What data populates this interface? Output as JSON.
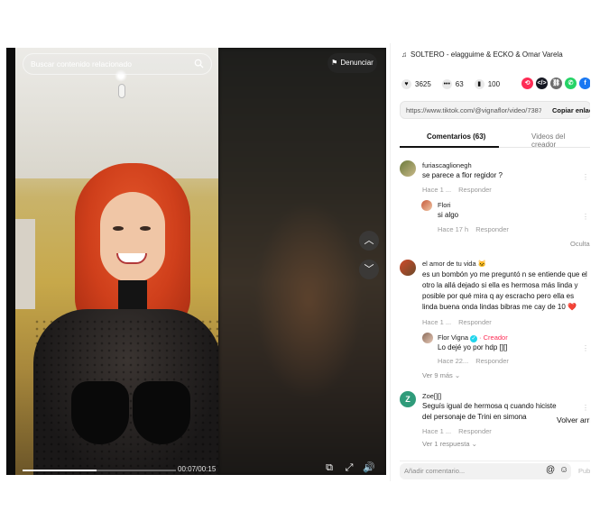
{
  "player": {
    "search_placeholder": "Buscar contenido relacionado",
    "report_label": "Denunciar",
    "report_icon": "flag-icon",
    "up_icon": "chevron-up-icon",
    "down_icon": "chevron-down-icon",
    "time": "00:07/00:15",
    "progress_fraction": 0.48
  },
  "panel": {
    "music": "SOLTERO - elagguime & ECKO & Omar Varela",
    "stats": {
      "likes": "3625",
      "comments": "63",
      "saves": "100"
    },
    "share_colors": [
      "#fe2c55",
      "#161823",
      "#6d6d6d",
      "#25d366",
      "#1877f2"
    ],
    "link": "https://www.tiktok.com/@vignaflor/video/738758...",
    "copy_label": "Copiar enlace",
    "tabs": {
      "comments": "Comentarios (63)",
      "videos": "Videos del creador"
    },
    "hide_label": "Ocultar",
    "back_to_top": "Volver arriba",
    "comment_placeholder": "Añadir comentario...",
    "post_label": "Publicar"
  },
  "comments": [
    {
      "user": "furiascaglionegh",
      "text": "se parece a flor regidor ?",
      "time": "Hace 1 ...",
      "reply": "Responder",
      "replies": [
        {
          "user": "Flori",
          "text": "si algo",
          "time": "Hace 17 h",
          "reply": "Responder"
        }
      ]
    },
    {
      "user": "el amor de tu vida 🐱",
      "text": "es un bombón yo me preguntó n se entiende que el otro la allá dejado si ella es hermosa más linda y posible por qué mira q ay escracho pero ella es linda buena onda lindas bibras me cay de 10 ❤️",
      "time": "Hace 1 ...",
      "reply": "Responder",
      "replies": [
        {
          "user": "Flor Vigna",
          "creator": "· Creador",
          "text": "Lo dejé yo por hdp [][]",
          "time": "Hace 22...",
          "reply": "Responder"
        }
      ],
      "more": "Ver 9 más"
    },
    {
      "user": "Zoe[][]",
      "avatar_letter": "Z",
      "text": "Seguís igual de hermosa q cuando hiciste del personaje de Trini en simona",
      "time": "Hace 1 ...",
      "reply": "Responder",
      "more": "Ver 1 respuesta"
    }
  ]
}
